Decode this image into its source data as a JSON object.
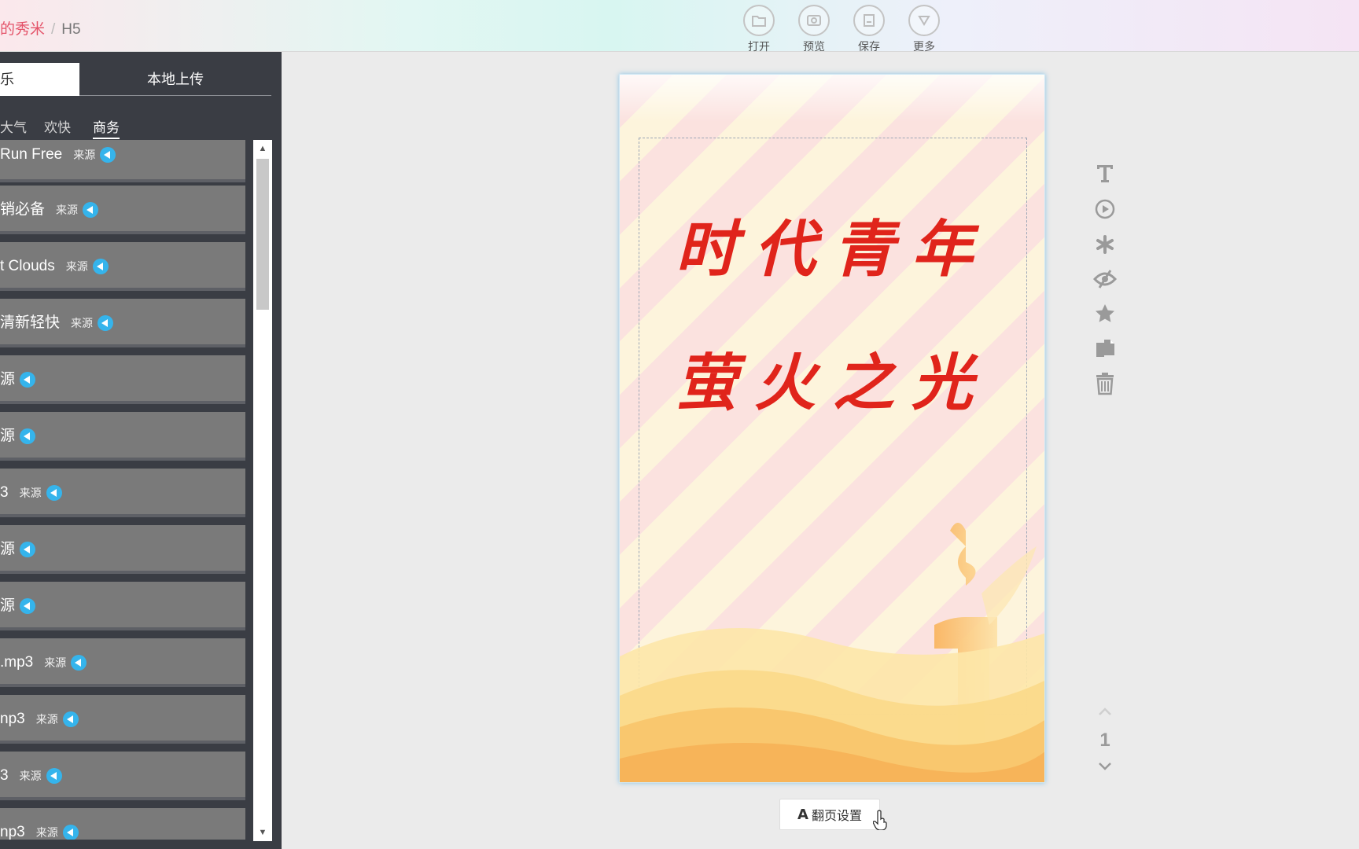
{
  "topbar": {
    "brand": "的秀米",
    "separator": "/",
    "crumb": "H5",
    "tools": [
      {
        "label": "打开",
        "icon": "folder-icon"
      },
      {
        "label": "预览",
        "icon": "preview-icon"
      },
      {
        "label": "保存",
        "icon": "save-icon"
      },
      {
        "label": "更多",
        "icon": "more-icon"
      }
    ]
  },
  "left": {
    "tab_active": "乐",
    "tab_upload": "本地上传",
    "categories": [
      "大气",
      "欢快",
      "商务"
    ],
    "active_category": "商务",
    "source_label": "来源",
    "items": [
      {
        "title": "Run Free"
      },
      {
        "title": "销必备"
      },
      {
        "title": "t Clouds"
      },
      {
        "title": "清新轻快"
      },
      {
        "title": "源"
      },
      {
        "title": "源"
      },
      {
        "title": "3"
      },
      {
        "title": "源"
      },
      {
        "title": "源"
      },
      {
        "title": ".mp3"
      },
      {
        "title": "np3"
      },
      {
        "title": "3"
      },
      {
        "title": "np3"
      }
    ]
  },
  "canvas": {
    "line1": "时代青年",
    "line2": "萤火之光"
  },
  "page_setting_btn": {
    "icon_char": "A",
    "label": "翻页设置"
  },
  "right_tools": [
    "text-icon",
    "play-circle-icon",
    "asterisk-icon",
    "eye-slash-icon",
    "star-icon",
    "copy-icon",
    "trash-icon"
  ],
  "pager": {
    "current": "1"
  }
}
